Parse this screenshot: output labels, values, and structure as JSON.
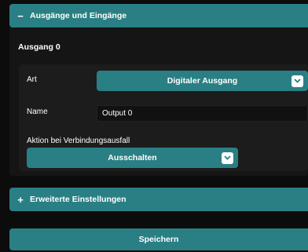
{
  "outputs_section": {
    "header_sign": "−",
    "header_label": "Ausgänge und Eingänge"
  },
  "output0": {
    "title": "Ausgang 0",
    "type_label": "Art",
    "type_value": "Digitaler Ausgang",
    "name_label": "Name",
    "name_value": "Output 0",
    "failure_label": "Aktion bei Verbindungsausfall",
    "failure_value": "Ausschalten"
  },
  "advanced_section": {
    "header_sign": "+",
    "header_label": "Erweiterte Einstellungen"
  },
  "save_label": "Speichern",
  "icons": {
    "collapse": "minus-icon",
    "expand": "plus-icon",
    "dropdown": "chevron-down-icon"
  },
  "colors": {
    "accent": "#2a7f84",
    "background": "#0c0c0c",
    "panel": "#151515",
    "subpanel": "#1c1c1c"
  }
}
